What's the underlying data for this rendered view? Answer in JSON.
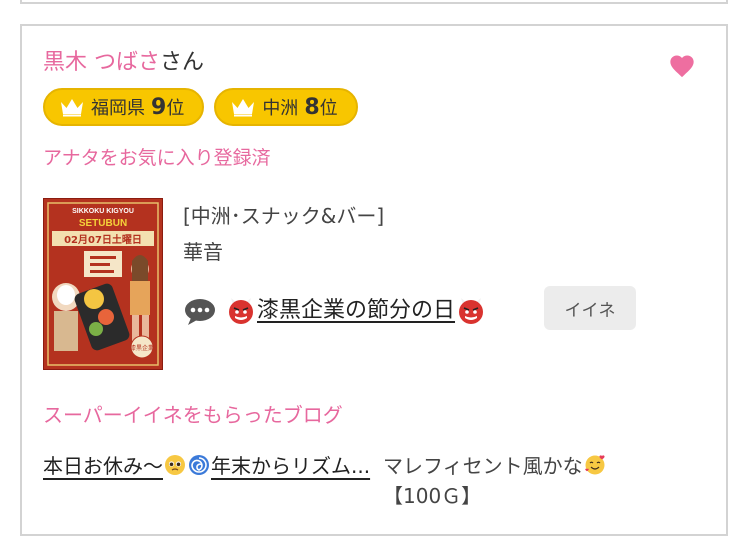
{
  "profile": {
    "name": "黒木 つばさ",
    "honorific": "さん",
    "favorite_icon": "heart-icon"
  },
  "badges": [
    {
      "area": "福岡県",
      "rank": "9",
      "unit": "位",
      "icon": "crown-icon"
    },
    {
      "area": "中洲",
      "rank": "8",
      "unit": "位",
      "icon": "crown-icon"
    }
  ],
  "favorite_status": "アナタをお気に入り登録済",
  "blog": {
    "shop_label": "[中洲･スナック&バー]",
    "cast_name": "華音",
    "title": "漆黒企業の節分の日",
    "iine_label": "イイネ",
    "thumbnail_text": {
      "brand": "SIKKOKU KIGYOU",
      "event": "SETUBUN",
      "date": "02月07日土曜日",
      "footer": "漆黒企業"
    }
  },
  "super_iine": {
    "heading": "スーパーイイネをもらったブログ",
    "blog_link_part1": "本日お休み〜",
    "blog_link_part2": "年末からリズム...",
    "description_text": "マレフィセント風かな",
    "reward": "【100Ｇ】"
  },
  "colors": {
    "pink": "#e7689e",
    "badge_yellow": "#f8c600",
    "border": "#d3d3d3"
  }
}
